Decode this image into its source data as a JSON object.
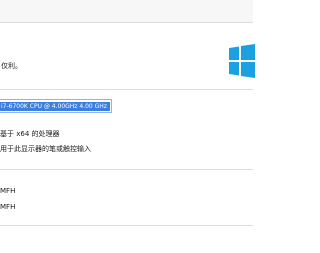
{
  "header": {
    "rights_fragment": "仅利。"
  },
  "windows_logo": {
    "icon": "windows-logo",
    "color": "#1ba1e2"
  },
  "system": {
    "processor_value": "i7-6700K CPU @ 4.00GHz   4.00 GHz",
    "system_type_fragment": "基于 x64 的处理器",
    "pen_touch_fragment": "用于此显示器的笔或触控输入"
  },
  "names": {
    "computer_name": "MFH",
    "full_computer_name": "MFH"
  },
  "colors": {
    "selection": "#3c7fe0",
    "accent": "#1ba1e2"
  }
}
